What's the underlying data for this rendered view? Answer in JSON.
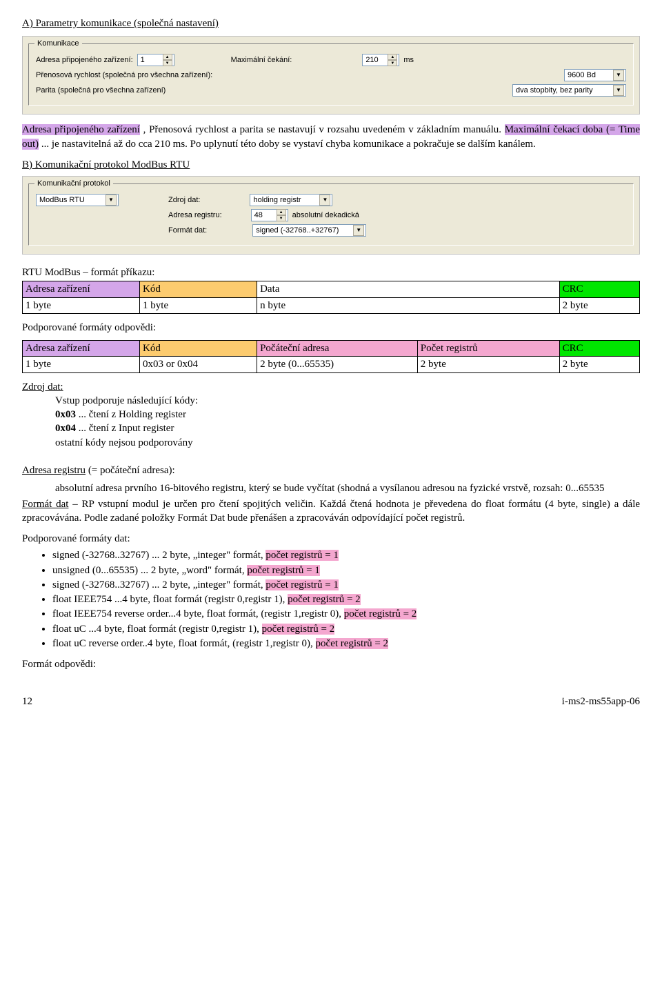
{
  "headings": {
    "a": "A) Parametry komunikace (společná nastavení)",
    "b": "B) Komunikační protokol ModBus RTU",
    "rtu_format": "RTU ModBus – formát příkazu:",
    "resp_formats": "Podporované formáty odpovědi:",
    "zdroj": "Zdroj dat:",
    "adresa_reg": "Adresa registru",
    "adresa_reg_suffix": " (= počáteční adresa):",
    "format_dat_prefix": "Formát dat",
    "format_dat_body": " – RP vstupní modul je určen pro čtení spojitých veličin. Každá čtená hodnota je převedena do float formátu (4 byte, single) a dále zpracovávána. Podle zadané položky Formát Dat bude přenášen a zpracováván odpovídající počet registrů.",
    "dat_formats": "Podporované formáty dat:",
    "resp_format": "Formát odpovědi:"
  },
  "para_a": {
    "pre_hl": "",
    "hl1": "Adresa připojeného zařízení",
    "mid1": ", Přenosová rychlost a parita se nastavují v rozsahu uvedeném v základním manuálu. ",
    "hl2": "Maximální čekací doba (= Time out)",
    "mid2": " ... je nastavitelná až do cca 210 ms. Po uplynutí této doby se vystaví chyba komunikace a pokračuje se dalším kanálem."
  },
  "panel1": {
    "legend": "Komunikace",
    "label_addr": "Adresa připojeného zařízení:",
    "addr_value": "1",
    "label_wait": "Maximální čekání:",
    "wait_value": "210",
    "ms": "ms",
    "label_rate": "Přenosová rychlost (společná pro všechna zařízení):",
    "rate_value": "9600 Bd",
    "label_parity": "Parita (společná pro všechna zařízení)",
    "parity_value": "dva stopbity, bez parity"
  },
  "panel2": {
    "legend": "Komunikační protokol",
    "proto_value": "ModBus RTU",
    "label_source": "Zdroj dat:",
    "source_value": "holding registr",
    "label_reg": "Adresa registru:",
    "reg_value": "48",
    "reg_note": "absolutní dekadická",
    "label_fmt": "Formát dat:",
    "fmt_value": "signed (-32768..+32767)"
  },
  "table1": {
    "h1": "Adresa zařízení",
    "h2": "Kód",
    "h3": "Data",
    "h4": "CRC",
    "r1c1": "1 byte",
    "r1c2": "1 byte",
    "r1c3": "n byte",
    "r1c4": "2 byte"
  },
  "table2": {
    "h1": "Adresa zařízení",
    "h2": "Kód",
    "h3": "Počáteční adresa",
    "h4": "Počet registrů",
    "h5": "CRC",
    "r1c1": "1 byte",
    "r1c2": "0x03 or 0x04",
    "r1c3": "2 byte (0...65535)",
    "r1c4": "2 byte",
    "r1c5": "2 byte"
  },
  "zdroj_block": {
    "l1": "Vstup podporuje následující kódy:",
    "l2a": "0x03",
    "l2b": " ... čtení z Holding register",
    "l3a": "0x04",
    "l3b": " ... čtení z Input register",
    "l4": "ostatní kódy nejsou podporovány"
  },
  "adresa_block": {
    "l1": "absolutní adresa prvního 16-bitového registru, který se bude vyčítat (shodná a vysílanou adresou na fyzické vrstvě, rozsah: 0...65535"
  },
  "formats": [
    {
      "pre": "signed (-32768..32767) ... 2 byte, „integer\" formát, ",
      "hl": "počet registrů = 1"
    },
    {
      "pre": "unsigned (0...65535) ... 2 byte, „word\" formát, ",
      "hl": "počet registrů = 1"
    },
    {
      "pre": "signed (-32768..32767) ... 2 byte, „integer\" formát, ",
      "hl": " počet registrů = 1"
    },
    {
      "pre": "float IEEE754 ...4 byte, float formát (registr 0,registr 1), ",
      "hl": " počet registrů = 2"
    },
    {
      "pre": "float IEEE754 reverse order...4 byte, float formát, (registr 1,registr 0), ",
      "hl": " počet registrů = 2"
    },
    {
      "pre": "float uC ...4 byte, float formát (registr 0,registr 1), ",
      "hl": " počet registrů = 2"
    },
    {
      "pre": "float uC reverse order..4 byte, float formát, (registr 1,registr 0), ",
      "hl": " počet registrů = 2"
    }
  ],
  "footer": {
    "page": "12",
    "doc": "i-ms2-ms55app-06"
  }
}
